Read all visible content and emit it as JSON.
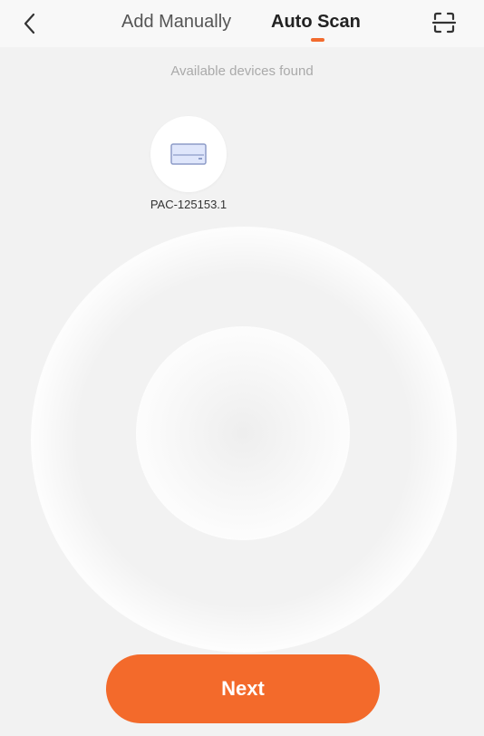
{
  "header": {
    "back_icon": "chevron-left-icon",
    "tabs": [
      {
        "label": "Add Manually",
        "active": false
      },
      {
        "label": "Auto Scan",
        "active": true
      }
    ],
    "scan_icon": "scan-frame-icon",
    "accent_color": "#f26b2e"
  },
  "subtitle": "Available devices found",
  "devices": [
    {
      "name": "PAC-125153.1",
      "icon": "air-conditioner-icon"
    }
  ],
  "next_button": {
    "label": "Next",
    "color": "#f36a2b"
  }
}
